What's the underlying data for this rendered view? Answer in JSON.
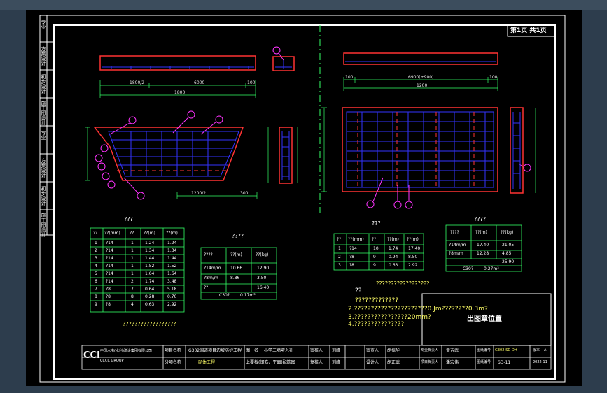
{
  "drawing": {
    "page_label": "第1页 共1页",
    "print_stamp": "出图章位置"
  },
  "left_side_labels": [
    "专业",
    "方案设计",
    "初步设计",
    "施工图设计",
    "专业",
    "方案设计",
    "初步设计",
    "施工图设计"
  ],
  "left_table": {
    "title": "???",
    "headers": [
      "??",
      "??(mm)",
      "??",
      "??(m)",
      "??(m)"
    ],
    "rows": [
      [
        "1",
        "?14",
        "1",
        "1.24",
        "1.24"
      ],
      [
        "2",
        "?14",
        "1",
        "1.34",
        "1.34"
      ],
      [
        "3",
        "?14",
        "1",
        "1.44",
        "1.44"
      ],
      [
        "4",
        "?14",
        "1",
        "1.52",
        "1.52"
      ],
      [
        "5",
        "?14",
        "1",
        "1.64",
        "1.64"
      ],
      [
        "6",
        "?14",
        "2",
        "1.74",
        "3.48"
      ],
      [
        "7",
        "?8",
        "7",
        "0.64",
        "5.18"
      ],
      [
        "8",
        "?8",
        "8",
        "0.28",
        "0.76"
      ],
      [
        "9",
        "?8",
        "4",
        "0.63",
        "2.92"
      ]
    ],
    "note": "??????????????????"
  },
  "mid_table": {
    "title": "????",
    "headers": [
      "????",
      "??(m)",
      "??(kg)"
    ],
    "rows": [
      [
        "?14m/m",
        "10.66",
        "12.90"
      ],
      [
        "?8m/m",
        "8.86",
        "3.50"
      ],
      [
        "??",
        "",
        "16.40"
      ]
    ],
    "footer": [
      "C30?",
      "0.17m³"
    ]
  },
  "right_table": {
    "title": "???",
    "headers": [
      "??",
      "??(mm)",
      "??",
      "??(m)",
      "??(m)"
    ],
    "rows": [
      [
        "1",
        "?14",
        "10",
        "1.74",
        "17.40"
      ],
      [
        "2",
        "?8",
        "9",
        "0.94",
        "8.50"
      ],
      [
        "3",
        "?8",
        "9",
        "0.63",
        "2.92"
      ]
    ],
    "note": "??????????????????"
  },
  "right_summary": {
    "title": "????",
    "headers": [
      "????",
      "??(m)",
      "??(kg)"
    ],
    "rows": [
      [
        "?14m/m",
        "17.40",
        "21.05"
      ],
      [
        "?8m/m",
        "12.28",
        "4.85"
      ],
      [
        "",
        "",
        "25.90"
      ]
    ],
    "footer": [
      "C30?",
      "0.27m³"
    ]
  },
  "notes": {
    "heading": "??",
    "line1": "?????????????",
    "line2": "2.??????????????????????0.Jm????????0.3m?",
    "line3": "3.????????????????20mm?",
    "line4": "4.???????????????"
  },
  "title_block": {
    "company_cn": "中国水电(水利)建设集团有限公司",
    "company_en": "CCCC GROUP",
    "logo_text": "CCI",
    "project_label": "项目名称",
    "project_value": "G302国道项目边坡防护工程",
    "subitem_label": "分项名称",
    "subitem_value": "砌体工程",
    "drawing_label": "图　名",
    "drawing_name_1": "小学三墙壁入孔",
    "drawing_name_2": "上覆板(钢筋、平面)配筋图",
    "approver": "审核人",
    "approver_name": "刘峰",
    "checker": "复核人",
    "checker_name": "刘峰",
    "reviewer": "审查人",
    "reviewer_name": "胡振华",
    "designer": "设计人",
    "designer_name": "胡正武",
    "manager": "专业负责人",
    "manager_name": "黄吉武",
    "project_lead": "项目负责人",
    "project_lead_name": "潘宏伟",
    "drawing_no_label": "图纸编号",
    "drawing_no": "G302-SD-DH",
    "ver_label": "版本",
    "ver": "A",
    "sheet_label": "图纸编号",
    "sheet_no": "SD-11",
    "date": "2022-11"
  },
  "dims": {
    "top_left": [
      "1800/2",
      "6000",
      "100",
      "1800"
    ],
    "top_right": [
      "100",
      "6900(+900)",
      "100",
      "1200"
    ],
    "bottom_left": [
      "1200/2",
      "300"
    ],
    "callouts": [
      "①",
      "②",
      "③",
      "④",
      "⑤",
      "⑥",
      "⑦",
      "⑧",
      "⑨"
    ]
  },
  "colors": {
    "background": "#000000",
    "rebar": "#3333ff",
    "outline": "#ff3333",
    "callout": "#ff33ff",
    "table_line": "#33ff66",
    "note": "#ffff66"
  }
}
